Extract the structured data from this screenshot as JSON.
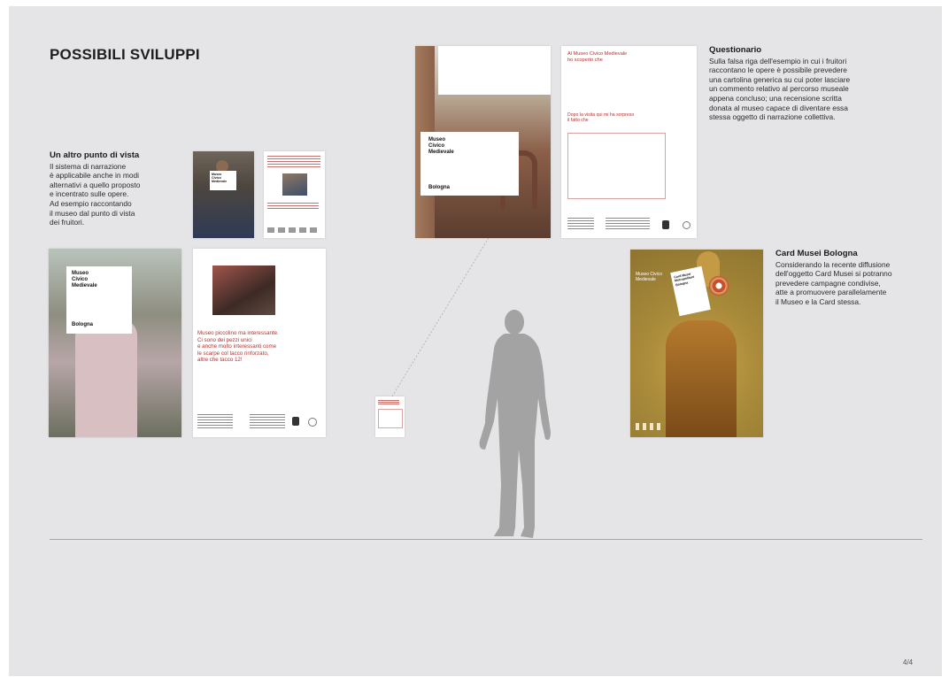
{
  "page": {
    "title": "POSSIBILI SVILUPPI",
    "page_number": "4/4"
  },
  "sections": {
    "altro_punto": {
      "heading": "Un altro punto di vista",
      "lines": [
        "Il sistema di narrazione",
        "è applicabile anche in modi",
        "alternativi a quello proposto",
        "e incentrato sulle opere.",
        "Ad esempio raccontando",
        "il museo dal punto di vista",
        "dei fruitori."
      ]
    },
    "questionario": {
      "heading": "Questionario",
      "lines": [
        "Sulla falsa riga dell'esempio in cui i fruitori",
        "raccontano le opere è possibile prevedere",
        "una cartolina generica su cui poter lasciare",
        "un commento relativo al percorso museale",
        "appena concluso; una recensione scritta",
        "donata al museo capace di diventare essa",
        "stessa oggetto di narrazione collettiva."
      ]
    },
    "card_musei": {
      "heading": "Card Musei Bologna",
      "lines": [
        "Considerando la recente diffusione",
        "dell'oggetto Card Musei si potranno",
        "prevedere campagne condivise,",
        "atte a promuovere parallelamente",
        "il Museo e la Card stessa."
      ]
    }
  },
  "posters": {
    "museo_label": [
      "Museo",
      "Civico",
      "Medievale"
    ],
    "bologna": "Bologna",
    "quote_red": [
      "Museo piccolino ma interessante.",
      "Ci sono dei pezzi unici",
      "e anche molto interessanti come",
      "le scarpe col tacco rinforzato,",
      "altre che tacco 12!"
    ],
    "questionario_heading": [
      "Al Museo Civico Medievale",
      "ho scoperto che"
    ],
    "questionario_sub": [
      "Dopo la visita qui mi ha sorpreso",
      "il fatto che"
    ],
    "card_label": [
      "Museo Civico",
      "Medievale"
    ],
    "card_badge": [
      "Card Musei",
      "Metropolitani",
      "Bologna"
    ]
  },
  "colors": {
    "background": "#e5e5e7",
    "accent_red": "#b3332f",
    "gold": "#a88a3a",
    "silhouette": "#a3a3a3"
  }
}
